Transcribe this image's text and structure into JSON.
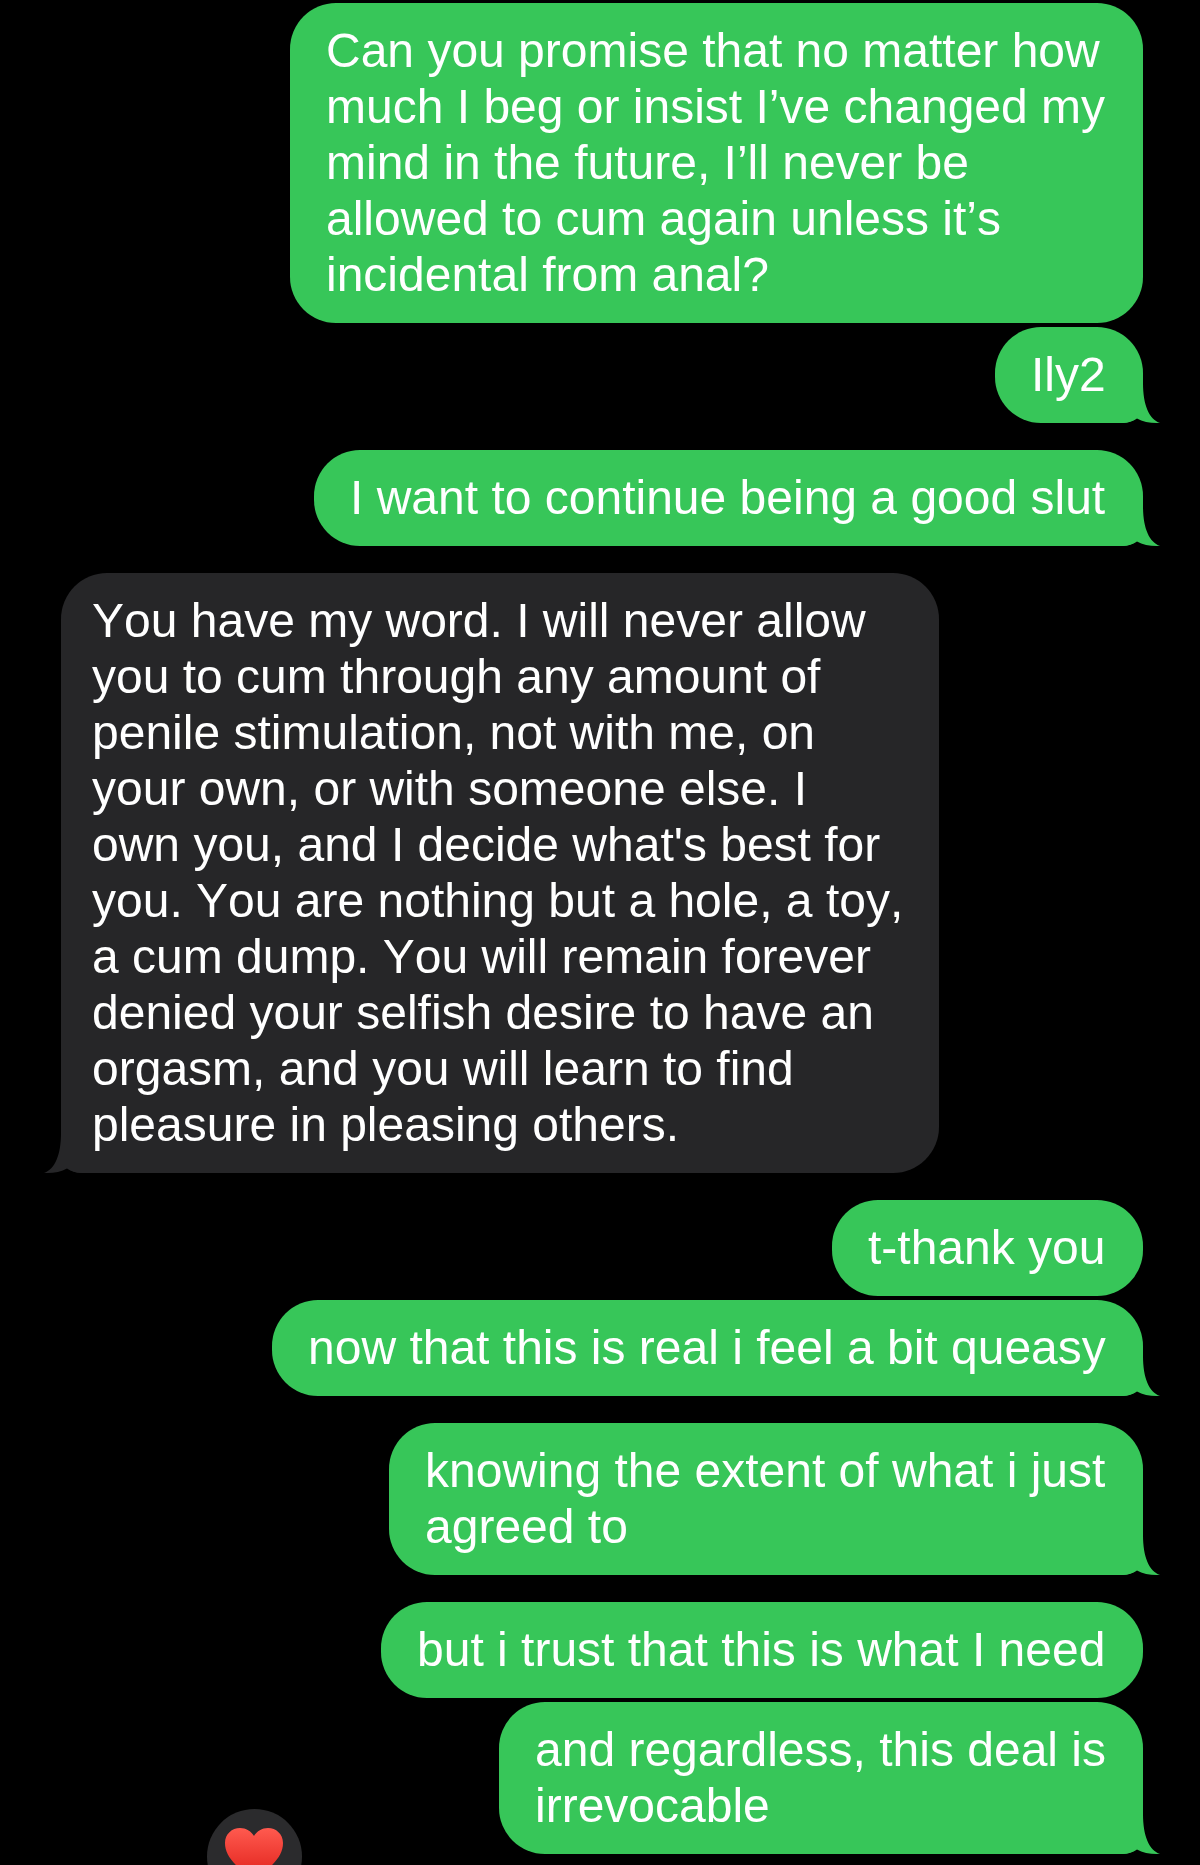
{
  "messages": [
    {
      "kind": "sent",
      "tail": false,
      "text": "Can you promise that no matter how much I beg or insist I’ve changed my mind in the future, I’ll never be allowed to cum again unless it’s incidental from anal?"
    },
    {
      "kind": "sent",
      "tail": true,
      "text": "Ily2"
    },
    {
      "kind": "sent",
      "tail": true,
      "text": "I want to continue being a good slut"
    },
    {
      "kind": "received",
      "tail": true,
      "text": "You have my word. I will never allow you to cum through any amount of penile stimulation, not with me, on your own, or with someone else. I own you, and I decide what's best for you. You are nothing but a hole, a toy, a cum dump. You will remain forever denied your selfish desire to have an orgasm, and you will learn to find pleasure in pleasing others."
    },
    {
      "kind": "sent",
      "tail": false,
      "text": "t-thank you"
    },
    {
      "kind": "sent",
      "tail": true,
      "text": "now that this is real i feel a bit queasy"
    },
    {
      "kind": "sent",
      "tail": true,
      "text": "knowing the extent of what i just agreed to"
    },
    {
      "kind": "sent",
      "tail": false,
      "text": "but i trust that this is what I need"
    },
    {
      "kind": "sent",
      "tail": true,
      "text": "and regardless, this deal is irrevocable"
    }
  ]
}
